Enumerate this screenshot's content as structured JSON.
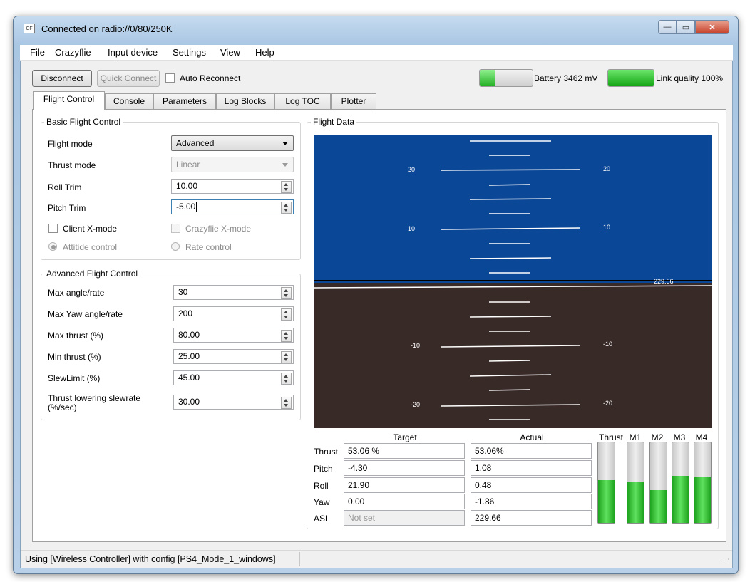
{
  "window": {
    "title": "Connected on radio://0/80/250K",
    "app_icon": "cf-app-icon"
  },
  "menu": [
    "File",
    "Crazyflie",
    "Input device",
    "Settings",
    "View",
    "Help"
  ],
  "toolbar": {
    "disconnect": "Disconnect",
    "quick_connect": "Quick Connect",
    "auto_reconnect": "Auto Reconnect"
  },
  "battery": {
    "label": "Battery 3462 mV",
    "level": 0.28
  },
  "link": {
    "label": "Link quality 100%",
    "level": 1.0
  },
  "tabs": [
    "Flight Control",
    "Console",
    "Parameters",
    "Log Blocks",
    "Log TOC",
    "Plotter"
  ],
  "basic": {
    "title": "Basic Flight Control",
    "flight_mode_label": "Flight mode",
    "flight_mode": "Advanced",
    "thrust_mode_label": "Thrust mode",
    "thrust_mode": "Linear",
    "roll_trim_label": "Roll Trim",
    "roll_trim": "10.00",
    "pitch_trim_label": "Pitch Trim",
    "pitch_trim": "-5.00",
    "client_xmode": "Client X-mode",
    "crazyflie_xmode": "Crazyflie X-mode",
    "attitude": "Attitide control",
    "rate": "Rate control"
  },
  "advanced": {
    "title": "Advanced Flight Control",
    "rows": [
      {
        "label": "Max angle/rate",
        "value": "30"
      },
      {
        "label": "Max Yaw angle/rate",
        "value": "200"
      },
      {
        "label": "Max thrust (%)",
        "value": "80.00"
      },
      {
        "label": "Min thrust (%)",
        "value": "25.00"
      },
      {
        "label": "SlewLimit (%)",
        "value": "45.00"
      },
      {
        "label": "Thrust lowering slewrate\n(%/sec)",
        "value": "30.00"
      }
    ]
  },
  "flight_data": {
    "title": "Flight Data",
    "horizon": {
      "altitude": "229.66",
      "marks": [
        "20",
        "10",
        "-10",
        "-20"
      ],
      "sky_color": "#0b4797",
      "ground_color": "#382a27"
    },
    "target_header": "Target",
    "actual_header": "Actual",
    "rows": [
      {
        "label": "Thrust",
        "target": "53.06 %",
        "actual": "53.06%"
      },
      {
        "label": "Pitch",
        "target": "-4.30",
        "actual": "1.08"
      },
      {
        "label": "Roll",
        "target": "21.90",
        "actual": "0.48"
      },
      {
        "label": "Yaw",
        "target": "0.00",
        "actual": "-1.86"
      },
      {
        "label": "ASL",
        "target": "Not set",
        "actual": "229.66"
      }
    ],
    "bars": [
      {
        "label": "Thrust",
        "level": 0.53
      },
      {
        "label": "M1",
        "level": 0.51
      },
      {
        "label": "M2",
        "level": 0.41
      },
      {
        "label": "M3",
        "level": 0.58
      },
      {
        "label": "M4",
        "level": 0.57
      }
    ]
  },
  "status": "Using [Wireless Controller] with config [PS4_Mode_1_windows]"
}
